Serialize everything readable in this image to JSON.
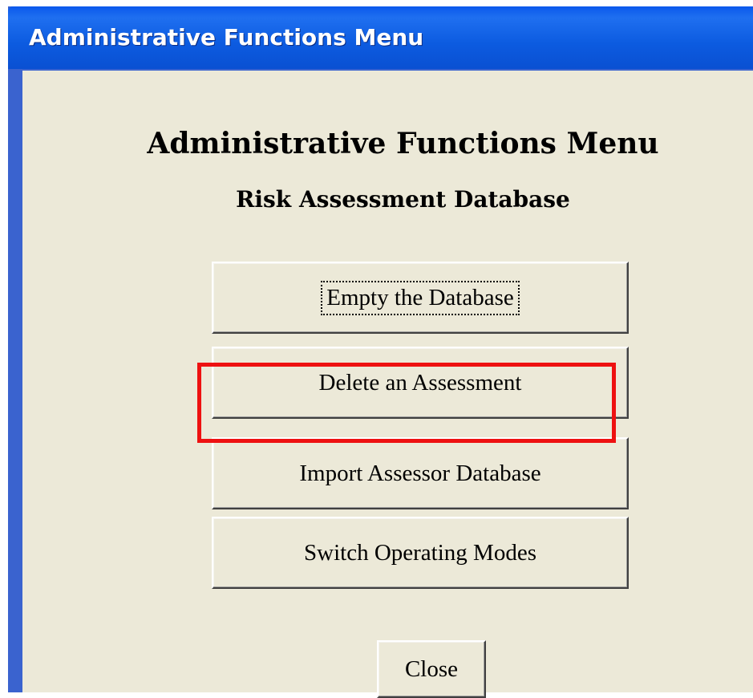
{
  "window": {
    "title": "Administrative Functions Menu"
  },
  "content": {
    "heading": "Administrative Functions Menu",
    "subheading": "Risk Assessment Database"
  },
  "buttons": {
    "empty_database": "Empty the Database",
    "delete_assessment": "Delete an Assessment",
    "import_assessor": "Import Assessor Database",
    "switch_modes": "Switch Operating Modes",
    "close": "Close"
  },
  "colors": {
    "titlebar": "#0a58ec",
    "client_background": "#ece9d8",
    "highlight": "#ee1111"
  }
}
